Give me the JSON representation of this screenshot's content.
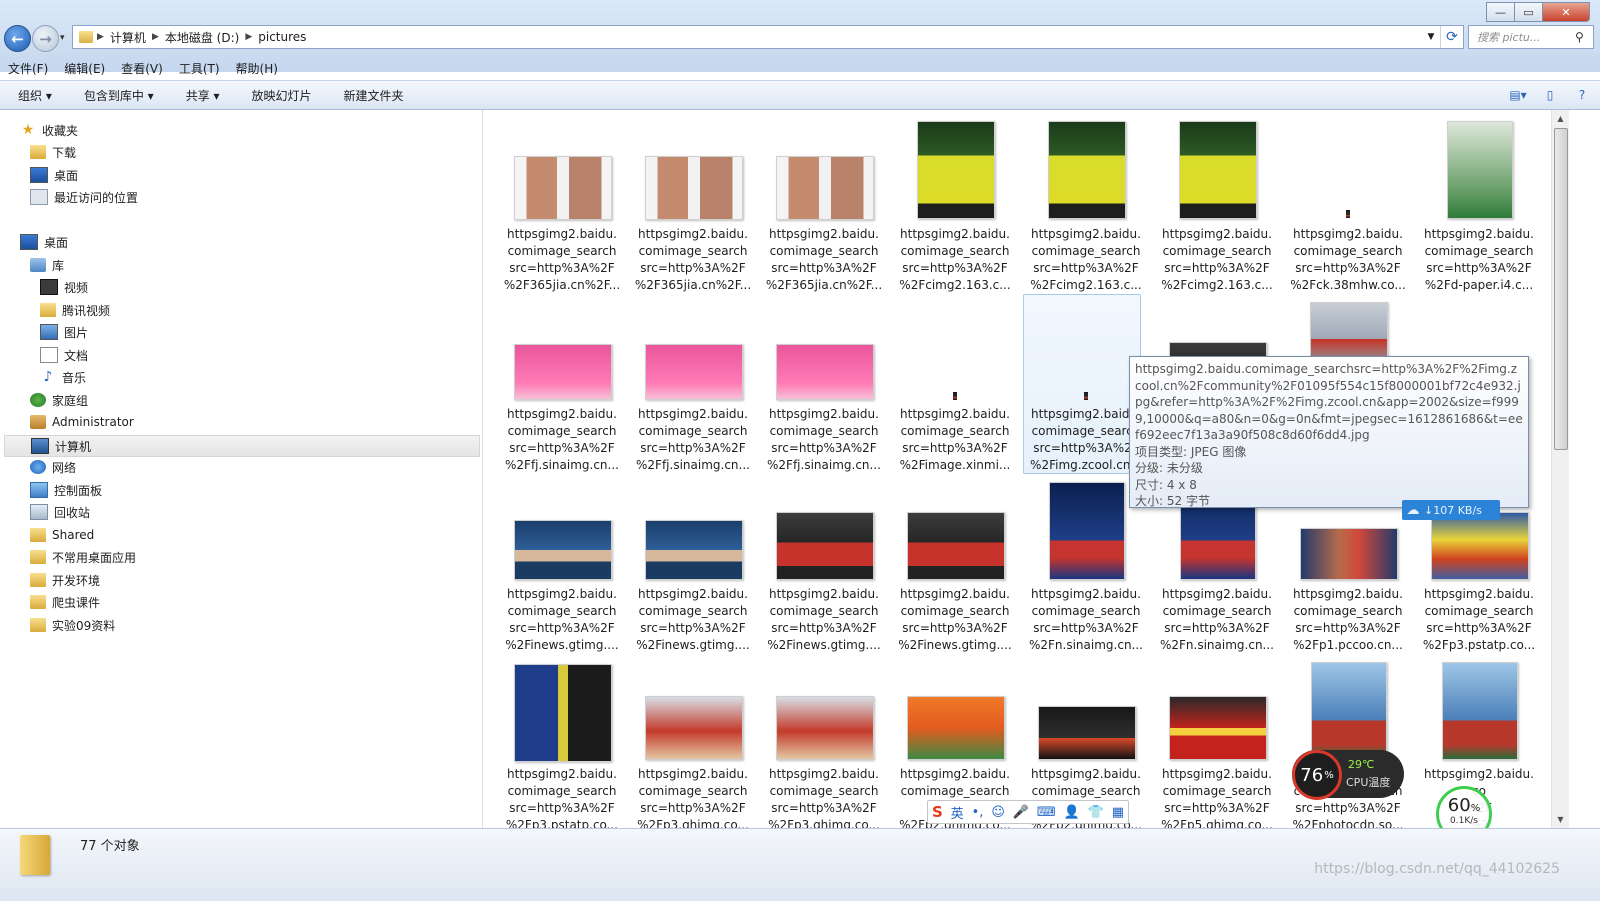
{
  "window": {
    "breadcrumb": [
      "计算机",
      "本地磁盘 (D:)",
      "pictures"
    ],
    "search_placeholder": "搜索 pictu...",
    "controls": {
      "minimize": "—",
      "maximize": "▭",
      "close": "✕"
    }
  },
  "menu": [
    "文件(F)",
    "编辑(E)",
    "查看(V)",
    "工具(T)",
    "帮助(H)"
  ],
  "toolbar": {
    "organize": "组织 ▾",
    "include_library": "包含到库中 ▾",
    "share": "共享 ▾",
    "slideshow": "放映幻灯片",
    "new_folder": "新建文件夹"
  },
  "sidebar": {
    "favorites": "收藏夹",
    "downloads": "下载",
    "desktop_fav": "桌面",
    "recent": "最近访问的位置",
    "desktop": "桌面",
    "libraries": "库",
    "videos": "视频",
    "tencent_video": "腾讯视频",
    "pictures": "图片",
    "documents": "文档",
    "music": "音乐",
    "homegroup": "家庭组",
    "administrator": "Administrator",
    "computer": "计算机",
    "network": "网络",
    "control_panel": "控制面板",
    "recycle_bin": "回收站",
    "shared": "Shared",
    "uncommon_apps": "不常用桌面应用",
    "dev_env": "开发环境",
    "crawler": "爬虫课件",
    "lab09": "实验09资料"
  },
  "files": [
    {
      "l1": "httpsgimg2.baidu.",
      "l2": "comimage_search",
      "l3": "src=http%3A%2F",
      "l4": "%2F365jia.cn%2F...",
      "thumb": "men"
    },
    {
      "l1": "httpsgimg2.baidu.",
      "l2": "comimage_search",
      "l3": "src=http%3A%2F",
      "l4": "%2F365jia.cn%2F...",
      "thumb": "men"
    },
    {
      "l1": "httpsgimg2.baidu.",
      "l2": "comimage_search",
      "l3": "src=http%3A%2F",
      "l4": "%2F365jia.cn%2F...",
      "thumb": "men"
    },
    {
      "l1": "httpsgimg2.baidu.",
      "l2": "comimage_search",
      "l3": "src=http%3A%2F",
      "l4": "%2Fcimg2.163.c...",
      "thumb": "yellow"
    },
    {
      "l1": "httpsgimg2.baidu.",
      "l2": "comimage_search",
      "l3": "src=http%3A%2F",
      "l4": "%2Fcimg2.163.c...",
      "thumb": "yellow"
    },
    {
      "l1": "httpsgimg2.baidu.",
      "l2": "comimage_search",
      "l3": "src=http%3A%2F",
      "l4": "%2Fcimg2.163.c...",
      "thumb": "yellow"
    },
    {
      "l1": "httpsgimg2.baidu.",
      "l2": "comimage_search",
      "l3": "src=http%3A%2F",
      "l4": "%2Fck.38mhw.co...",
      "thumb": "tiny"
    },
    {
      "l1": "httpsgimg2.baidu.",
      "l2": "comimage_search",
      "l3": "src=http%3A%2F",
      "l4": "%2Fd-paper.i4.c...",
      "thumb": "court"
    },
    {
      "l1": "httpsgimg2.baidu.",
      "l2": "comimage_search",
      "l3": "src=http%3A%2F",
      "l4": "%2Ffj.sinaimg.cn...",
      "thumb": "pink"
    },
    {
      "l1": "httpsgimg2.baidu.",
      "l2": "comimage_search",
      "l3": "src=http%3A%2F",
      "l4": "%2Ffj.sinaimg.cn...",
      "thumb": "pink"
    },
    {
      "l1": "httpsgimg2.baidu.",
      "l2": "comimage_search",
      "l3": "src=http%3A%2F",
      "l4": "%2Ffj.sinaimg.cn...",
      "thumb": "pink"
    },
    {
      "l1": "httpsgimg2.baidu.",
      "l2": "comimage_search",
      "l3": "src=http%3A%2F",
      "l4": "%2Fimage.xinmi...",
      "thumb": "tiny"
    },
    {
      "l1": "httpsgimg2.baidu.",
      "l2": "comimage_search",
      "l3": "src=http%3A%2F",
      "l4": "%2Fimg.zcool.cn...",
      "thumb": "tiny"
    },
    {
      "l1": "",
      "l2": "",
      "l3": "",
      "l4": "",
      "thumb": "grey"
    },
    {
      "l1": "",
      "l2": "",
      "l3": "",
      "l4": "",
      "thumb": "red"
    },
    {
      "l1": "",
      "l2": "",
      "l3": "",
      "l4": "",
      "thumb": "blue"
    },
    {
      "l1": "httpsgimg2.baidu.",
      "l2": "comimage_search",
      "l3": "src=http%3A%2F",
      "l4": "%2Finews.gtimg....",
      "thumb": "blue"
    },
    {
      "l1": "httpsgimg2.baidu.",
      "l2": "comimage_search",
      "l3": "src=http%3A%2F",
      "l4": "%2Finews.gtimg....",
      "thumb": "blue"
    },
    {
      "l1": "httpsgimg2.baidu.",
      "l2": "comimage_search",
      "l3": "src=http%3A%2F",
      "l4": "%2Finews.gtimg....",
      "thumb": "red"
    },
    {
      "l1": "httpsgimg2.baidu.",
      "l2": "comimage_search",
      "l3": "src=http%3A%2F",
      "l4": "%2Finews.gtimg....",
      "thumb": "red"
    },
    {
      "l1": "httpsgimg2.baidu.",
      "l2": "comimage_search",
      "l3": "src=http%3A%2F",
      "l4": "%2Fn.sinaimg.cn...",
      "thumb": "arena"
    },
    {
      "l1": "httpsgimg2.baidu.",
      "l2": "comimage_search",
      "l3": "src=http%3A%2F",
      "l4": "%2Fn.sinaimg.cn...",
      "thumb": "arena"
    },
    {
      "l1": "httpsgimg2.baidu.",
      "l2": "comimage_search",
      "l3": "src=http%3A%2F",
      "l4": "%2Fp1.pccoo.cn...",
      "thumb": "kiss"
    },
    {
      "l1": "httpsgimg2.baidu.",
      "l2": "comimage_search",
      "l3": "src=http%3A%2F",
      "l4": "%2Fp3.pstatp.co...",
      "thumb": "court3"
    },
    {
      "l1": "httpsgimg2.baidu.",
      "l2": "comimage_search",
      "l3": "src=http%3A%2F",
      "l4": "%2Fp3.pstatp.co...",
      "thumb": "fedex"
    },
    {
      "l1": "httpsgimg2.baidu.",
      "l2": "comimage_search",
      "l3": "src=http%3A%2F",
      "l4": "%2Fp3.qhimg.co...",
      "thumb": "salute"
    },
    {
      "l1": "httpsgimg2.baidu.",
      "l2": "comimage_search",
      "l3": "src=http%3A%2F",
      "l4": "%2Fp3.qhimg.co...",
      "thumb": "salute"
    },
    {
      "l1": "httpsgimg2.baidu.",
      "l2": "comimage_search",
      "l3": "src=",
      "l4": "%2Fp2.qhimg.co...",
      "thumb": "orange"
    },
    {
      "l1": "httpsgimg2.baidu.",
      "l2": "comimage_search",
      "l3": "",
      "l4": "%2Fp2.qhimg.co...",
      "thumb": "dark"
    },
    {
      "l1": "httpsgimg2.baidu.",
      "l2": "comimage_search",
      "l3": "src=http%3A%2F",
      "l4": "%2Fp5.qhimg.co...",
      "thumb": "flag"
    },
    {
      "l1": "httpsgimg2.baidu.",
      "l2": "comimage_search",
      "l3": "src=http%3A%2F",
      "l4": "%2Fphotocdn.so...",
      "thumb": "court2"
    },
    {
      "l1": "httpsgimg2.baidu.",
      "l2": "co",
      "l3": "%2F",
      "l4": "%2",
      "thumb": "court2"
    }
  ],
  "tooltip": {
    "path": "httpsgimg2.baidu.comimage_searchsrc=http%3A%2F%2Fimg.zcool.cn%2Fcommunity%2F01095f554c15f8000001bf72c4e932.jpg&refer=http%3A%2F%2Fimg.zcool.cn&app=2002&size=f9999,10000&q=a80&n=0&g=0n&fmt=jpegsec=1612861686&t=eef692eec7f13a3a90f508c8d60f6dd4.jpg",
    "type": "项目类型: JPEG 图像",
    "rating": "分级: 未分级",
    "dimensions": "尺寸: 4 x 8",
    "size": "大小: 52 字节"
  },
  "overlays": {
    "net_speed": "107 KB/s",
    "cpu_percent": "76",
    "cpu_pct_sign": "%",
    "cpu_temp": "29℃",
    "cpu_label": "CPU温度",
    "mem_percent": "60",
    "mem_pct_sign": "%",
    "mem_speed": "0.1K/s",
    "ime_lang": "英"
  },
  "status": {
    "count": "77 个对象",
    "watermark": "https://blog.csdn.net/qq_44102625"
  }
}
